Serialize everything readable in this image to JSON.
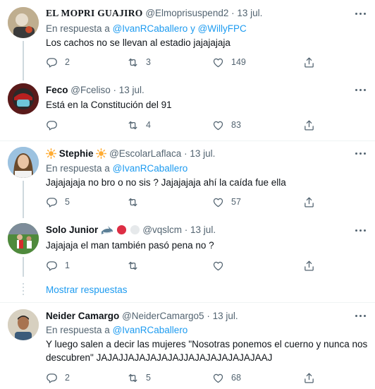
{
  "tweets": [
    {
      "name": "EL MOPRI GUAJIRO",
      "handle": "@Elmoprisuspend2",
      "date": "· 13 jul.",
      "reply_prefix": "En respuesta a ",
      "reply_user1": "@IvanRCaballero",
      "reply_join": " y ",
      "reply_user2": "@WillyFPC",
      "text": "Los cachos no se llevan al estadio jajajajaja",
      "replies": "2",
      "retweets": "3",
      "likes": "149"
    },
    {
      "name": "Feco",
      "handle": "@Fceliso",
      "date": "· 13 jul.",
      "text": "Está en la Constitución del 91",
      "replies": "",
      "retweets": "4",
      "likes": "83"
    },
    {
      "name": "Stephie",
      "handle": "@EscolarLaflaca",
      "date": "· 13 jul.",
      "reply_prefix": "En respuesta a ",
      "reply_user1": "@IvanRCaballero",
      "text": "Jajajajaja no bro o no sis ? Jajajajaja ahí la caída fue ella",
      "replies": "5",
      "retweets": "",
      "likes": "57"
    },
    {
      "name": "Solo Junior",
      "handle": "@vqslcm",
      "date": "· 13 jul.",
      "text": "Jajajaja el man también pasó pena no ?",
      "replies": "1",
      "retweets": "",
      "likes": ""
    },
    {
      "name": "Neider Camargo",
      "handle": "@NeiderCamargo5",
      "date": "· 13 jul.",
      "reply_prefix": "En respuesta a ",
      "reply_user1": "@IvanRCaballero",
      "text_line1": "Y luego salen a decir las mujeres \"Nosotras ponemos el cuerno y nunca nos",
      "text_line2": "descubren\" JAJAJJAJAJAJAJAJJAJAJAJAJAJAJAAJ",
      "replies": "2",
      "retweets": "5",
      "likes": "68"
    }
  ],
  "show_more": "Mostrar respuestas",
  "icons": {
    "reply": "reply-icon",
    "retweet": "retweet-icon",
    "like": "heart-icon",
    "share": "share-icon",
    "more": "more-icon"
  },
  "colors": {
    "link": "#1d9bf0",
    "secondary": "#536471",
    "divider": "#eff3f4"
  }
}
